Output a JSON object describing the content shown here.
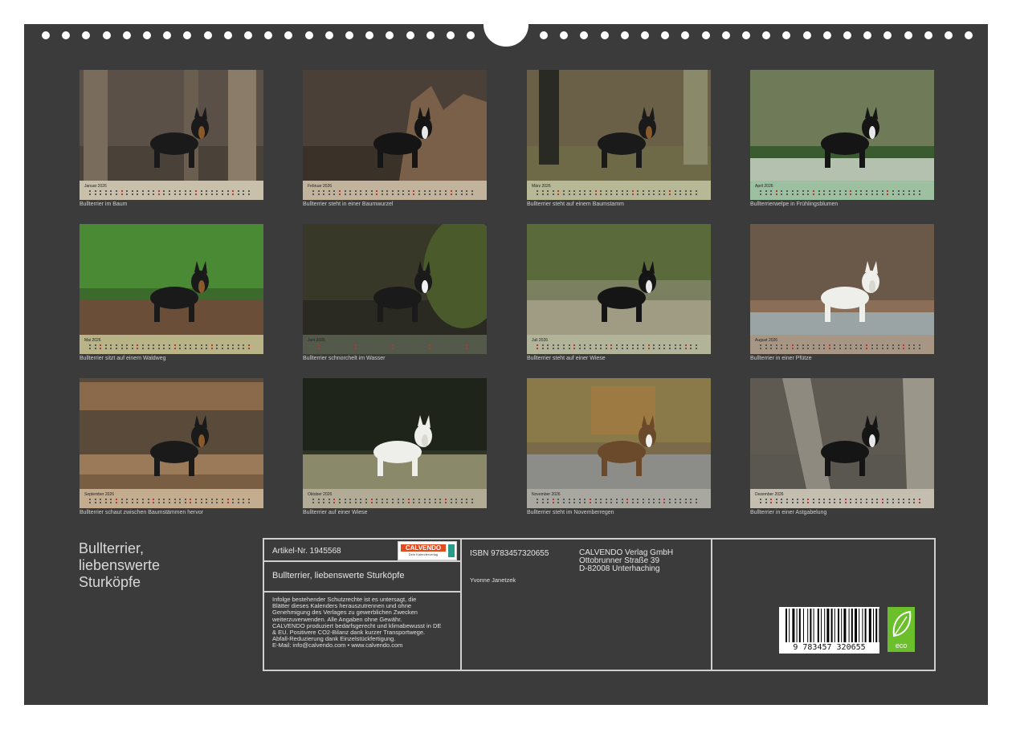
{
  "months": [
    {
      "name": "Januar 2026",
      "caption": "Bullterrier im Baum",
      "strip": "#c8c0aa",
      "scene": "trees",
      "bg": "#5a5048",
      "dog": "black-tan"
    },
    {
      "name": "Februar 2026",
      "caption": "Bullterrier steht in einer Baumwurzel",
      "strip": "#c2b49c",
      "scene": "stump",
      "bg": "#4a4038",
      "dog": "black"
    },
    {
      "name": "März 2026",
      "caption": "Bullterrier steht auf einem Baumstamm",
      "strip": "#b6b896",
      "scene": "log",
      "bg": "#6a6048",
      "dog": "black-tan"
    },
    {
      "name": "April 2026",
      "caption": "Bullterrierwelpe in Frühlingsblumen",
      "strip": "#9cc0a0",
      "scene": "flowers",
      "bg": "#6e7a58",
      "dog": "black"
    },
    {
      "name": "Mai 2026",
      "caption": "Bullterrier sitzt auf einem Waldweg",
      "strip": "#b8b488",
      "scene": "forest",
      "bg": "#3c6a2c",
      "dog": "black-tan"
    },
    {
      "name": "Juni 2026",
      "caption": "Bullterrier schnorchelt im Wasser",
      "strip": "#545a4a",
      "scene": "water",
      "bg": "#383828",
      "dog": "white-face"
    },
    {
      "name": "Juli 2026",
      "caption": "Bullterrier steht auf einer Wiese",
      "strip": "#b2b49a",
      "scene": "meadow",
      "bg": "#7a8060",
      "dog": "black"
    },
    {
      "name": "August 2026",
      "caption": "Bullterrier in einer Pfütze",
      "strip": "#a89684",
      "scene": "puddle",
      "bg": "#6a5848",
      "dog": "white"
    },
    {
      "name": "September 2026",
      "caption": "Bullterrier schaut zwischen Baumstämmen hervor",
      "strip": "#c4ac8e",
      "scene": "logs",
      "bg": "#5a4a3a",
      "dog": "black-tan"
    },
    {
      "name": "Oktober 2026",
      "caption": "Bullterrier auf einer Wiese",
      "strip": "#b2ac96",
      "scene": "grass",
      "bg": "#2e3428",
      "dog": "white"
    },
    {
      "name": "November 2026",
      "caption": "Bullterrier steht im Novemberregen",
      "strip": "#a8a8a0",
      "scene": "road",
      "bg": "#7a6a4a",
      "dog": "brindle"
    },
    {
      "name": "Dezember 2026",
      "caption": "Bullterrier in einer Astgabelung",
      "strip": "#c4beb0",
      "scene": "fork",
      "bg": "#5e5a52",
      "dog": "black"
    }
  ],
  "title": "Bullterrier, liebenswerte Sturköpfe",
  "title_lines": [
    "Bullterrier,",
    "liebenswerte",
    "Sturköpfe"
  ],
  "info": {
    "article": "Artikel-Nr. 1945568",
    "logo": "CALVENDO",
    "logo_sub": "Dein Kalenderverlag",
    "product_title": "Bullterrier, liebenswerte Sturköpfe",
    "isbn": "ISBN 9783457320655",
    "publisher": [
      "CALVENDO Verlag GmbH",
      "Ottobrunner Straße 39",
      "D-82008 Unterhaching"
    ],
    "author": "Yvonne Janetzek",
    "legal": [
      "Infolge bestehender Schutzrechte ist es untersagt, die",
      "Blätter dieses Kalenders herauszutrennen und ohne",
      "Genehmigung des Verlages zu gewerblichen Zwecken",
      "weiterzuverwenden. Alle Angaben ohne Gewähr.",
      "CALVENDO produziert bedarfsgerecht und klimabewusst in DE",
      "& EU. Positivere CO2-Bilanz dank kurzer Transportwege.",
      "Abfall-Reduzierung dank Einzelstückfertigung.",
      "E-Mail: info@calvendo.com • www.calvendo.com"
    ],
    "barcode_digits": "9 783457 320655",
    "eco_label": "eco"
  },
  "colors": {
    "sheet": "#3b3b3b",
    "text": "#d8d8d8",
    "border": "#cfcfcf",
    "eco": "#6bbf2a",
    "calvendo": "#e34a1e"
  }
}
